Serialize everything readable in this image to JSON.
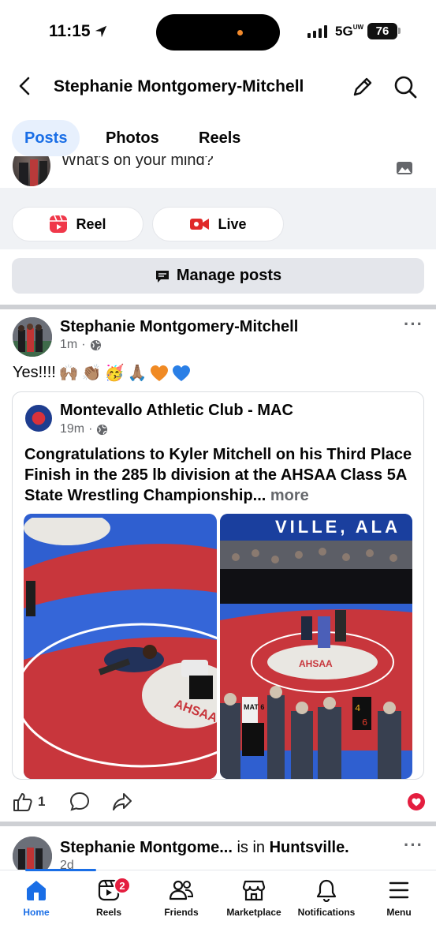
{
  "status_bar": {
    "time": "11:15",
    "network": "5G",
    "network_sub": "UW",
    "battery": "76"
  },
  "header": {
    "title": "Stephanie Montgomery-Mitchell"
  },
  "tabs": [
    {
      "label": "Posts",
      "active": true
    },
    {
      "label": "Photos",
      "active": false
    },
    {
      "label": "Reels",
      "active": false
    }
  ],
  "composer": {
    "placeholder": "What's on your mind?"
  },
  "create_buttons": {
    "reel_label": "Reel",
    "live_label": "Live"
  },
  "manage_posts": {
    "label": "Manage posts"
  },
  "post": {
    "author": "Stephanie Montgomery-Mitchell",
    "time": "1m",
    "audience_icon": "globe-icon",
    "text": "Yes!!!!",
    "emojis": [
      "raising-hands",
      "clapping-hands",
      "partying-face",
      "folded-hands",
      "orange-heart",
      "blue-heart"
    ],
    "shared": {
      "author": "Montevallo Athletic Club - MAC",
      "time": "19m",
      "text": "Congratulations to Kyler Mitchell on his Third Place Finish in the 285 lb division at the AHSAA Class 5A State Wrestling Championship...",
      "more_label": "more",
      "mat_text": "AHSAA",
      "banner_text": "VILLE, ALA",
      "scoreboard_left": "4",
      "scoreboard_right": "6",
      "mat_sign": "MAT 6"
    },
    "likes_count": "1"
  },
  "next_post": {
    "author": "Stephanie Montgome...",
    "connector": "is in",
    "place": "Huntsville.",
    "time": "2d"
  },
  "bottom_nav": [
    {
      "label": "Home",
      "active": true
    },
    {
      "label": "Reels",
      "badge": "2"
    },
    {
      "label": "Friends"
    },
    {
      "label": "Marketplace"
    },
    {
      "label": "Notifications"
    },
    {
      "label": "Menu"
    }
  ],
  "colors": {
    "accent": "#1a6ee6",
    "badge_red": "#e41e3f",
    "heart_red": "#e41e3f",
    "mat_red": "#c8363c",
    "mat_blue": "#2f5fd0"
  }
}
